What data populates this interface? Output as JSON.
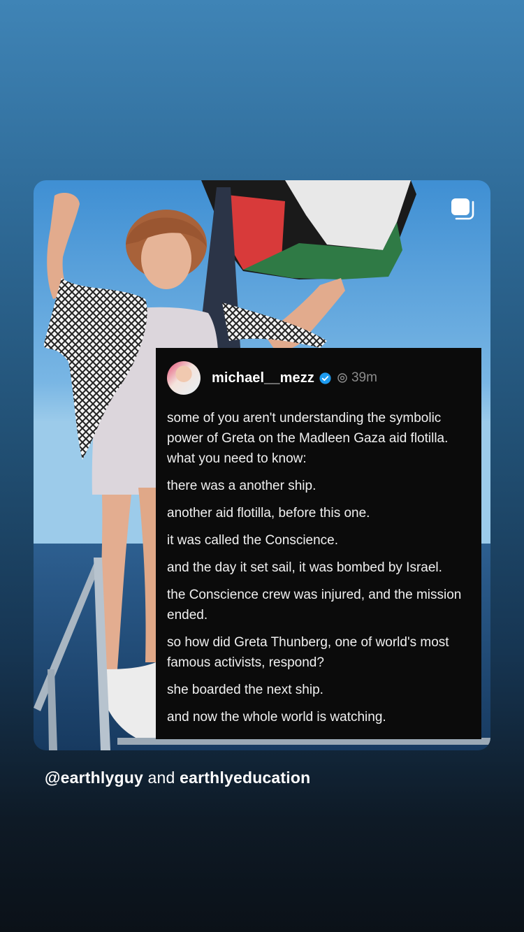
{
  "post": {
    "username": "michael__mezz",
    "timestamp": "39m",
    "paragraphs": [
      "some of you aren't understanding the symbolic power of Greta on the Madleen Gaza aid flotilla. what you need to know:",
      "there was a another ship.",
      "another aid flotilla, before this one.",
      "it was called the Conscience.",
      "and the day it set sail, it was bombed by Israel.",
      "the Conscience crew was injured, and the mission ended.",
      "so how did Greta Thunberg, one of world's most famous activists, respond?",
      "she boarded the next ship.",
      "and now the whole world is watching."
    ]
  },
  "caption": {
    "mention": "@earthlyguy",
    "connector": "and",
    "account": "earthlyeducation"
  },
  "icons": {
    "multi_post": "carousel-icon",
    "verified": "verified-badge-icon",
    "threads": "threads-icon"
  },
  "colors": {
    "verified": "#1d9bf0",
    "post_background": "#0b0b0b"
  }
}
